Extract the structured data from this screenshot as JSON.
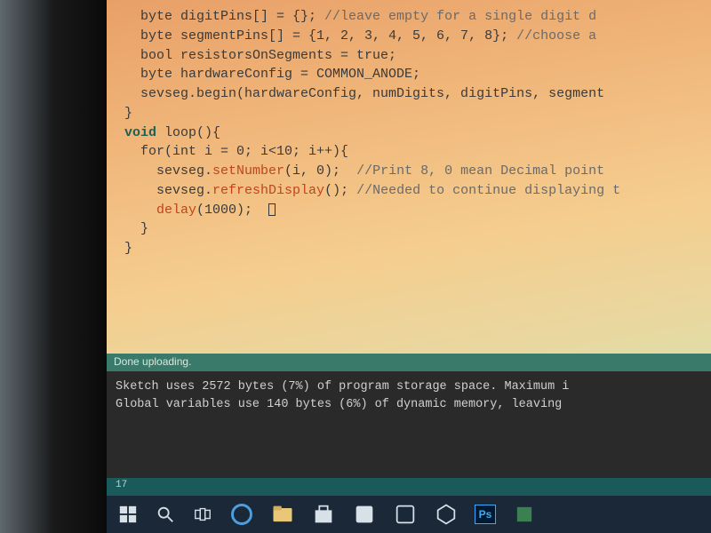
{
  "code": {
    "l1a": "  byte digitPins[] = {}; ",
    "l1b": "//leave empty for a single digit d",
    "l2a": "  byte segmentPins[] = {1, 2, 3, 4, 5, 6, 7, 8}; ",
    "l2b": "//choose a",
    "l3": "  bool resistorsOnSegments = true;",
    "l4": "  byte hardwareConfig = COMMON_ANODE;",
    "l5": "  sevseg.begin(hardwareConfig, numDigits, digitPins, segment",
    "l6": "}",
    "l7": "",
    "l8_kw": "void",
    "l8_rest": " loop(){",
    "l9a": "  for(int i = 0; i<10; i++){",
    "l10a": "    sevseg.",
    "l10fn": "setNumber",
    "l10b": "(i, 0);  ",
    "l10c": "//Print 8, 0 mean Decimal point ",
    "l11a": "    sevseg.",
    "l11fn": "refreshDisplay",
    "l11b": "(); ",
    "l11c": "//Needed to continue displaying t",
    "l12a": "    ",
    "l12fn": "delay",
    "l12b": "(1000);  ",
    "l13": "  }",
    "l14": "}"
  },
  "status": "Done uploading.",
  "console": {
    "line1": "Sketch uses 2572 bytes (7%) of program storage space. Maximum i",
    "line2": "Global variables use 140 bytes (6%) of dynamic memory, leaving "
  },
  "line_number": "17",
  "taskbar": {
    "ps_label": "Ps"
  }
}
